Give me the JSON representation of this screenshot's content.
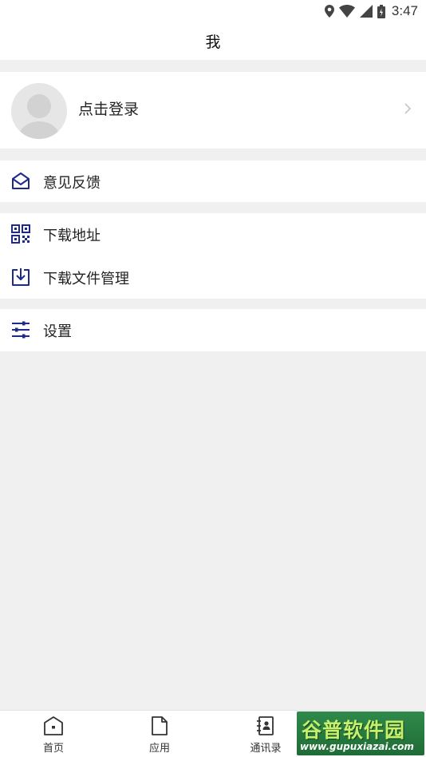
{
  "status_bar": {
    "time": "3:47",
    "icons": [
      "location-icon",
      "wifi-icon",
      "signal-icon",
      "battery-icon"
    ]
  },
  "header": {
    "title": "我"
  },
  "profile": {
    "login_label": "点击登录"
  },
  "menu": {
    "feedback": "意见反馈",
    "download_address": "下载地址",
    "download_manager": "下载文件管理",
    "settings": "设置"
  },
  "bottom_nav": {
    "items": [
      {
        "label": "首页",
        "icon": "home-icon"
      },
      {
        "label": "应用",
        "icon": "file-icon"
      },
      {
        "label": "通讯录",
        "icon": "contacts-icon"
      }
    ]
  },
  "watermark": {
    "title": "谷普软件园",
    "url": "www.gupuxiazai.com"
  },
  "colors": {
    "accent": "#1d2a8a",
    "background": "#f0f0f0",
    "card": "#ffffff"
  }
}
